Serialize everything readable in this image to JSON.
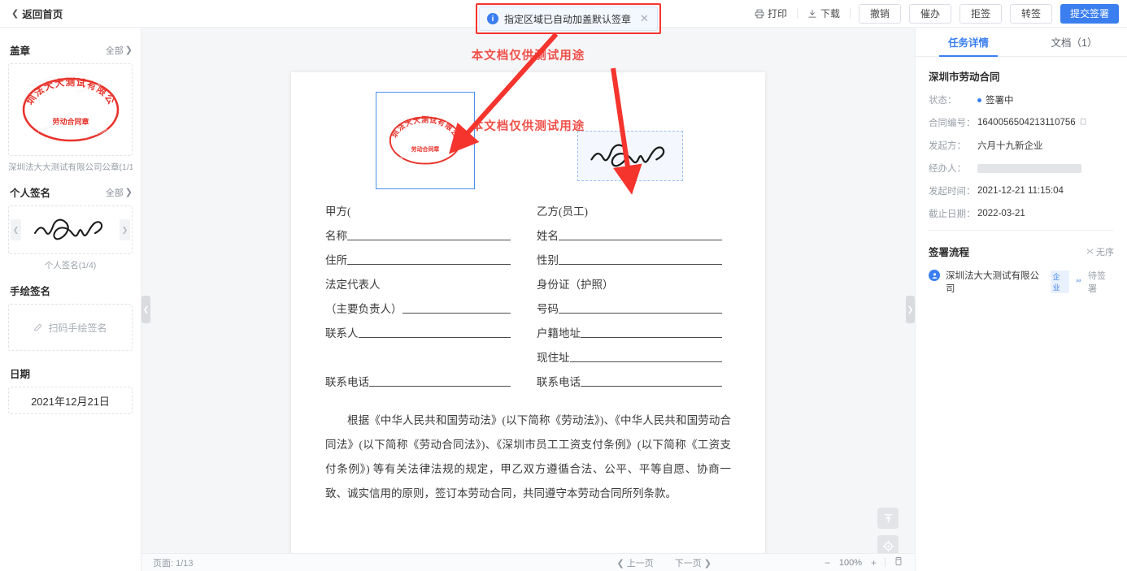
{
  "topbar": {
    "back_label": "返回首页",
    "print_label": "打印",
    "download_label": "下载",
    "buttons": [
      {
        "label": "撤销",
        "primary": false
      },
      {
        "label": "催办",
        "primary": false
      },
      {
        "label": "拒签",
        "primary": false
      },
      {
        "label": "转签",
        "primary": false
      },
      {
        "label": "提交签署",
        "primary": true
      }
    ]
  },
  "notification": {
    "text": "指定区域已自动加盖默认签章",
    "close": "✕",
    "icon": "info-icon"
  },
  "sidebar": {
    "seal": {
      "title": "盖章",
      "all_label": "全部",
      "caption": "深圳法大大测试有限公司公章(1/1)",
      "seal_company": "深圳法大大测试有限公司",
      "seal_type": "劳动合同章"
    },
    "signature": {
      "title": "个人签名",
      "all_label": "全部",
      "caption": "个人签名(1/4)"
    },
    "handwrite": {
      "title": "手绘签名",
      "action_label": "扫码手绘签名"
    },
    "date": {
      "title": "日期",
      "value": "2021年12月21日"
    }
  },
  "document": {
    "watermark": "本文档仅供测试用途",
    "left_column": [
      {
        "label": "甲方(",
        "line": false
      },
      {
        "label": "名称",
        "line": true
      },
      {
        "label": "住所",
        "line": true
      },
      {
        "label": "法定代表人",
        "line": false
      },
      {
        "label": "（主要负责人）",
        "line": true
      },
      {
        "label": "联系人",
        "line": true
      },
      {
        "label": "",
        "line": false
      },
      {
        "label": "联系电话",
        "line": true
      }
    ],
    "right_column": [
      {
        "label": "乙方(员工)",
        "line": false
      },
      {
        "label": "姓名",
        "line": true
      },
      {
        "label": "性别",
        "line": true
      },
      {
        "label": "身份证（护照）",
        "line": false
      },
      {
        "label": "号码",
        "line": true
      },
      {
        "label": "户籍地址",
        "line": true
      },
      {
        "label": "现住址",
        "line": true
      },
      {
        "label": "联系电话",
        "line": true
      }
    ],
    "paragraph": "根据《中华人民共和国劳动法》(以下简称《劳动法》)、《中华人民共和国劳动合同法》(以下简称《劳动合同法》)、《深圳市员工工资支付条例》(以下简称《工资支付条例》) 等有关法律法规的规定，甲乙双方遵循合法、公平、平等自愿、协商一致、诚实信用的原则，签订本劳动合同，共同遵守本劳动合同所列条款。"
  },
  "footer": {
    "page_label": "页面:",
    "page_value": "1/13",
    "prev_label": "上一页",
    "next_label": "下一页",
    "zoom_out": "−",
    "zoom_value": "100%",
    "zoom_in": "+",
    "fit_icon": "fit-page-icon"
  },
  "right_panel": {
    "tabs": [
      {
        "label": "任务详情",
        "active": true
      },
      {
        "label": "文档（1）",
        "active": false
      }
    ],
    "doc_title": "深圳市劳动合同",
    "fields": [
      {
        "key": "状态：",
        "value": "签署中",
        "type": "status"
      },
      {
        "key": "合同编号：",
        "value": "1640056504213110756",
        "type": "copyable"
      },
      {
        "key": "发起方：",
        "value": "六月十九新企业",
        "type": "text"
      },
      {
        "key": "经办人：",
        "value": "",
        "type": "redacted"
      },
      {
        "key": "发起时间：",
        "value": "2021-12-21 11:15:04",
        "type": "text"
      },
      {
        "key": "截止日期：",
        "value": "2022-03-21",
        "type": "text"
      }
    ],
    "flow": {
      "title": "签署流程",
      "order_label": "无序",
      "signer_name": "深圳法大大测试有限公司",
      "signer_tag": "企业",
      "signer_status": "待签署"
    }
  },
  "colors": {
    "primary": "#3a7ef0",
    "seal_red": "#e8342c",
    "annotation_red": "#f5342e"
  }
}
